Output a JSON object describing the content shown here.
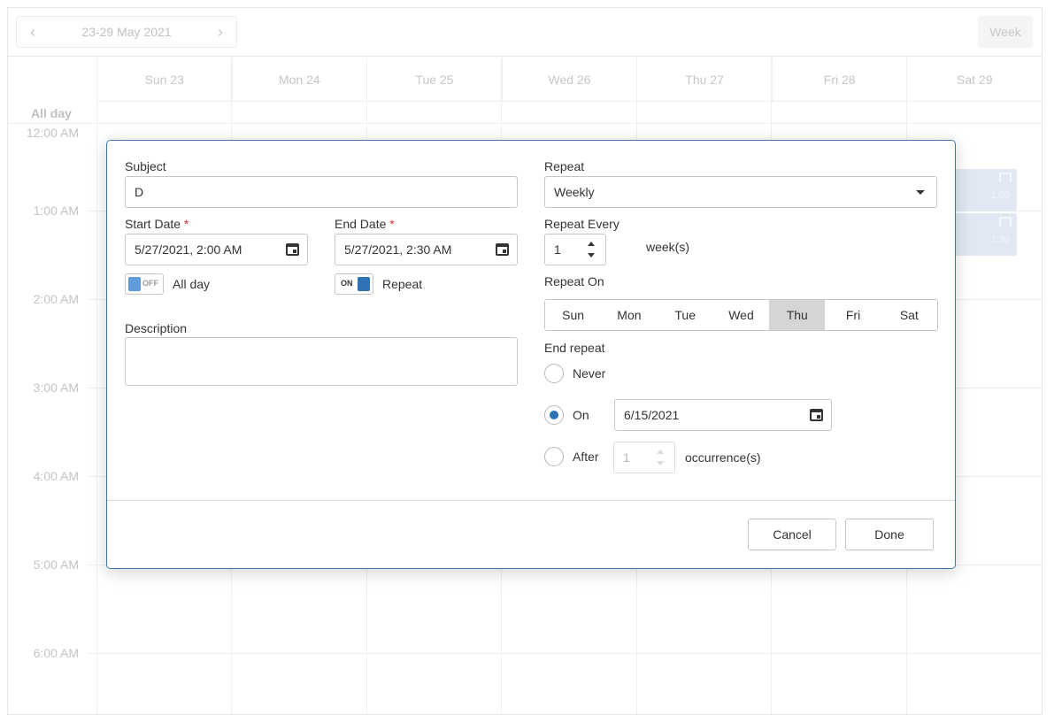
{
  "scheduler": {
    "date_range": "23-29 May 2021",
    "view": "Week",
    "days": [
      "Sun 23",
      "Mon 24",
      "Tue 25",
      "Wed 26",
      "Thu 27",
      "Fri 28",
      "Sat 29"
    ],
    "all_day_label": "All day",
    "times": [
      "12:00 AM",
      "1:00 AM",
      "2:00 AM",
      "3:00 AM",
      "4:00 AM",
      "5:00 AM",
      "6:00 AM"
    ],
    "events": [
      {
        "time": "1:00"
      },
      {
        "time": "1:30"
      }
    ]
  },
  "dialog": {
    "subject": {
      "label": "Subject",
      "value": "D"
    },
    "start_date": {
      "label": "Start Date",
      "required": "*",
      "value": "5/27/2021, 2:00 AM"
    },
    "end_date": {
      "label": "End Date",
      "required": "*",
      "value": "5/27/2021, 2:30 AM"
    },
    "all_day": {
      "label": "All day",
      "state": "OFF"
    },
    "repeat_toggle": {
      "label": "Repeat",
      "state": "ON"
    },
    "description": {
      "label": "Description",
      "value": ""
    },
    "repeat": {
      "label": "Repeat",
      "value": "Weekly"
    },
    "repeat_every": {
      "label": "Repeat Every",
      "value": "1",
      "unit": "week(s)"
    },
    "repeat_on": {
      "label": "Repeat On",
      "days": [
        "Sun",
        "Mon",
        "Tue",
        "Wed",
        "Thu",
        "Fri",
        "Sat"
      ],
      "selected": "Thu"
    },
    "end_repeat": {
      "label": "End repeat",
      "options": {
        "never": "Never",
        "on": "On",
        "after": "After"
      },
      "selected": "on",
      "on_date": "6/15/2021",
      "after_count": "1",
      "after_unit": "occurrence(s)"
    },
    "buttons": {
      "cancel": "Cancel",
      "done": "Done"
    }
  },
  "colors": {
    "accent": "#2f72b5",
    "dialog_border": "#3b79b5",
    "selected_day_bg": "#d5d5d5",
    "required": "#d9342b"
  }
}
